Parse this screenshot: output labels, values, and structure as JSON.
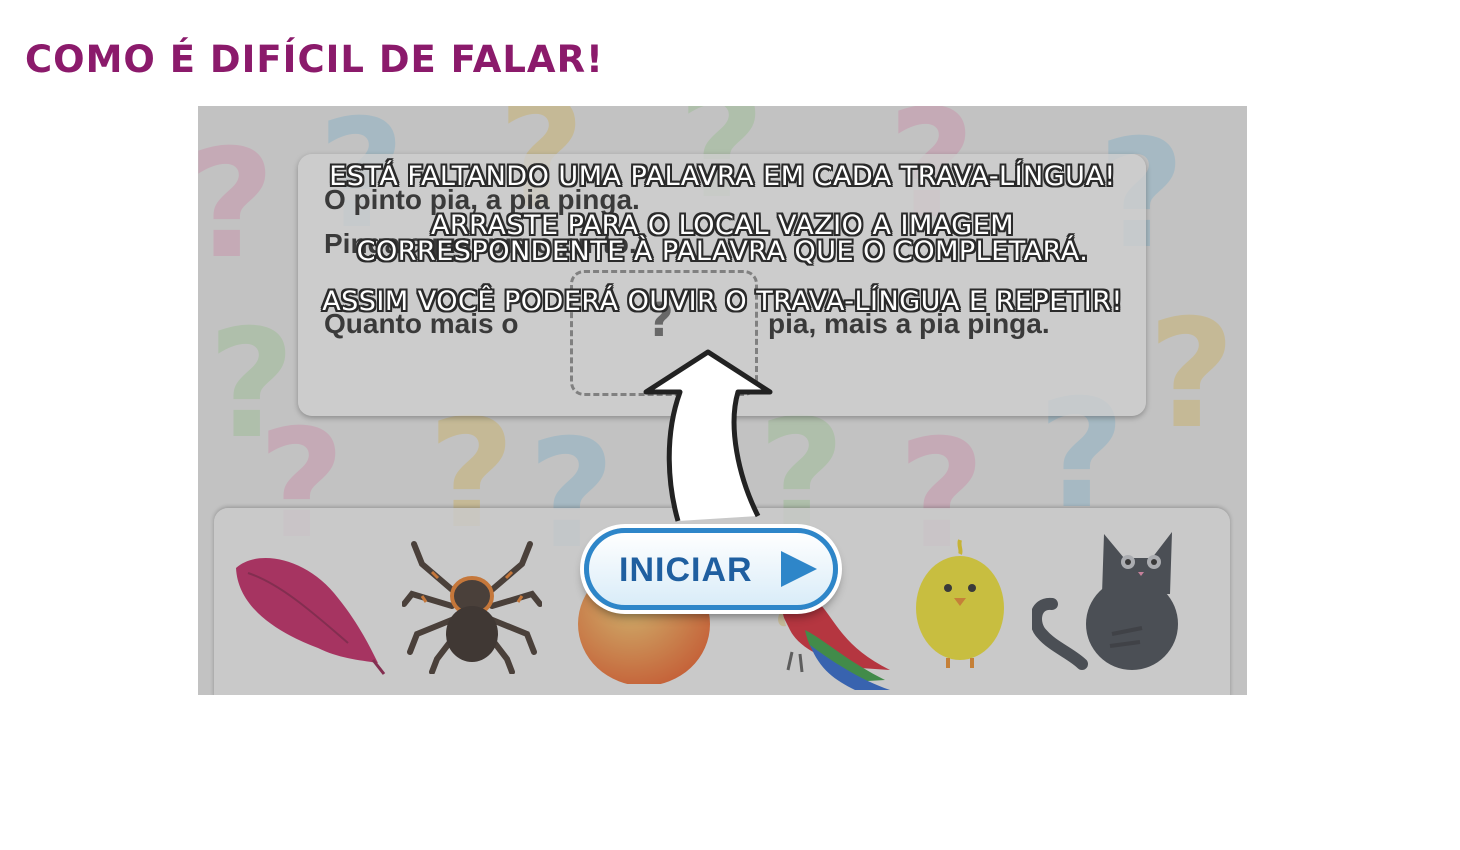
{
  "page": {
    "title": "COMO É DIFÍCIL DE FALAR!"
  },
  "poem": {
    "line1": "O pinto pia, a pia pinga.",
    "line2": "Pinga a pia, pia o pinto.",
    "line3_start": "Quanto mais o",
    "line3_end": "pia, mais a pia pinga.",
    "blank_symbol": "?"
  },
  "instructions": {
    "line1": "ESTÁ FALTANDO UMA PALAVRA EM CADA TRAVA-LÍNGUA!",
    "line2": "ARRASTE PARA O LOCAL VAZIO A IMAGEM",
    "line3": "CORRESPONDENTE À PALAVRA QUE O COMPLETARÁ.",
    "line4": "ASSIM VOCÊ PODERÁ OUVIR O TRAVA-LÍNGUA E REPETIR!"
  },
  "start_button": {
    "label": "INICIAR",
    "icon": "play-triangle-icon"
  },
  "tray": {
    "items": [
      "sweet-potato-icon",
      "spider-icon",
      "peach-icon",
      "parrot-icon",
      "chick-icon",
      "cat-icon"
    ]
  },
  "colors": {
    "title": "#8b1a6b",
    "button_border": "#2e86c9",
    "button_text": "#1f5fa0"
  }
}
